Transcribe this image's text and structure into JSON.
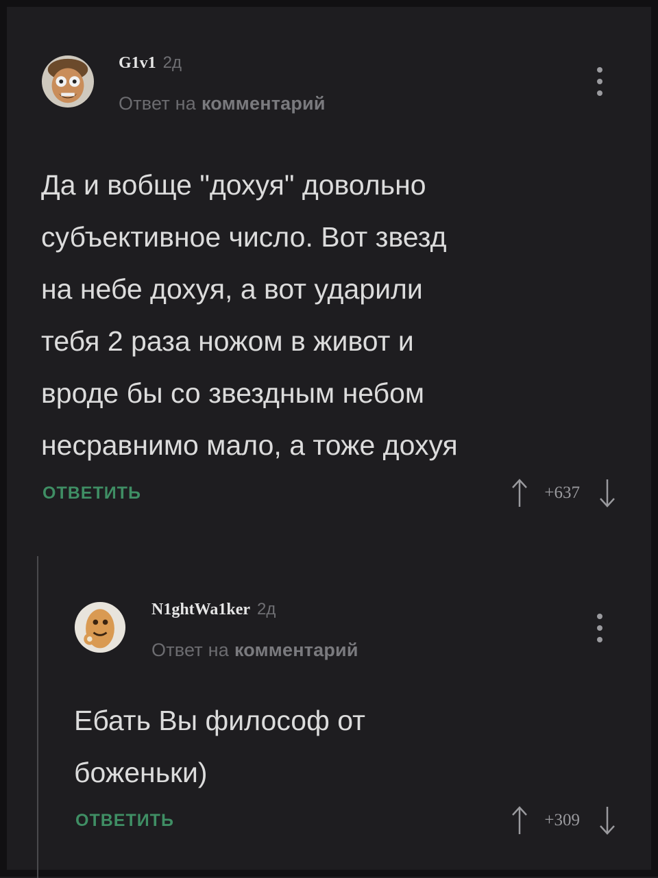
{
  "comments": [
    {
      "username": "G1v1",
      "time": "2д",
      "reply_prefix": "Ответ на",
      "reply_target": "комментарий",
      "text": "Да и вобще \"дохуя\" довольно\nсубъективное число. Вот звезд\nна небе дохуя, а вот ударили\nтебя 2 раза ножом в живот и\nвроде бы со звездным небом\nнесравнимо мало, а тоже дохуя",
      "reply_label": "ОТВЕТИТЬ",
      "score": "+637"
    },
    {
      "username": "N1ghtWa1ker",
      "time": "2д",
      "reply_prefix": "Ответ на",
      "reply_target": "комментарий",
      "text": "Ебать Вы философ от\nбоженьки)",
      "reply_label": "ОТВЕТИТЬ",
      "score": "+309"
    }
  ],
  "colors": {
    "background": "#1e1d20",
    "accent_green": "#3f8e64",
    "text": "#dcdcdc",
    "muted": "#6c6c70"
  },
  "icons": [
    "avatar-cartoon",
    "avatar-cookie",
    "more-vertical-icon",
    "arrow-up-icon",
    "arrow-down-icon"
  ]
}
